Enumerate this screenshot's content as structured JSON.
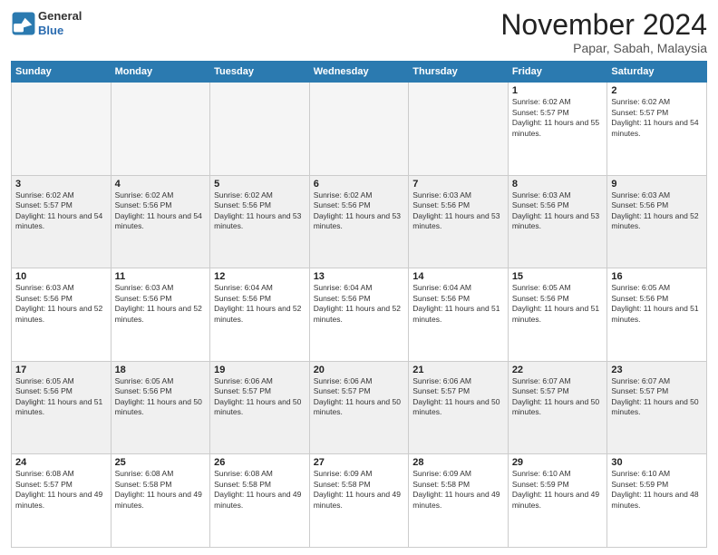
{
  "header": {
    "logo_general": "General",
    "logo_blue": "Blue",
    "month": "November 2024",
    "location": "Papar, Sabah, Malaysia"
  },
  "days_of_week": [
    "Sunday",
    "Monday",
    "Tuesday",
    "Wednesday",
    "Thursday",
    "Friday",
    "Saturday"
  ],
  "weeks": [
    [
      {
        "day": "",
        "empty": true
      },
      {
        "day": "",
        "empty": true
      },
      {
        "day": "",
        "empty": true
      },
      {
        "day": "",
        "empty": true
      },
      {
        "day": "",
        "empty": true
      },
      {
        "day": "1",
        "sunrise": "6:02 AM",
        "sunset": "5:57 PM",
        "daylight": "11 hours and 55 minutes."
      },
      {
        "day": "2",
        "sunrise": "6:02 AM",
        "sunset": "5:57 PM",
        "daylight": "11 hours and 54 minutes."
      }
    ],
    [
      {
        "day": "3",
        "sunrise": "6:02 AM",
        "sunset": "5:57 PM",
        "daylight": "11 hours and 54 minutes."
      },
      {
        "day": "4",
        "sunrise": "6:02 AM",
        "sunset": "5:56 PM",
        "daylight": "11 hours and 54 minutes."
      },
      {
        "day": "5",
        "sunrise": "6:02 AM",
        "sunset": "5:56 PM",
        "daylight": "11 hours and 53 minutes."
      },
      {
        "day": "6",
        "sunrise": "6:02 AM",
        "sunset": "5:56 PM",
        "daylight": "11 hours and 53 minutes."
      },
      {
        "day": "7",
        "sunrise": "6:03 AM",
        "sunset": "5:56 PM",
        "daylight": "11 hours and 53 minutes."
      },
      {
        "day": "8",
        "sunrise": "6:03 AM",
        "sunset": "5:56 PM",
        "daylight": "11 hours and 53 minutes."
      },
      {
        "day": "9",
        "sunrise": "6:03 AM",
        "sunset": "5:56 PM",
        "daylight": "11 hours and 52 minutes."
      }
    ],
    [
      {
        "day": "10",
        "sunrise": "6:03 AM",
        "sunset": "5:56 PM",
        "daylight": "11 hours and 52 minutes."
      },
      {
        "day": "11",
        "sunrise": "6:03 AM",
        "sunset": "5:56 PM",
        "daylight": "11 hours and 52 minutes."
      },
      {
        "day": "12",
        "sunrise": "6:04 AM",
        "sunset": "5:56 PM",
        "daylight": "11 hours and 52 minutes."
      },
      {
        "day": "13",
        "sunrise": "6:04 AM",
        "sunset": "5:56 PM",
        "daylight": "11 hours and 52 minutes."
      },
      {
        "day": "14",
        "sunrise": "6:04 AM",
        "sunset": "5:56 PM",
        "daylight": "11 hours and 51 minutes."
      },
      {
        "day": "15",
        "sunrise": "6:05 AM",
        "sunset": "5:56 PM",
        "daylight": "11 hours and 51 minutes."
      },
      {
        "day": "16",
        "sunrise": "6:05 AM",
        "sunset": "5:56 PM",
        "daylight": "11 hours and 51 minutes."
      }
    ],
    [
      {
        "day": "17",
        "sunrise": "6:05 AM",
        "sunset": "5:56 PM",
        "daylight": "11 hours and 51 minutes."
      },
      {
        "day": "18",
        "sunrise": "6:05 AM",
        "sunset": "5:56 PM",
        "daylight": "11 hours and 50 minutes."
      },
      {
        "day": "19",
        "sunrise": "6:06 AM",
        "sunset": "5:57 PM",
        "daylight": "11 hours and 50 minutes."
      },
      {
        "day": "20",
        "sunrise": "6:06 AM",
        "sunset": "5:57 PM",
        "daylight": "11 hours and 50 minutes."
      },
      {
        "day": "21",
        "sunrise": "6:06 AM",
        "sunset": "5:57 PM",
        "daylight": "11 hours and 50 minutes."
      },
      {
        "day": "22",
        "sunrise": "6:07 AM",
        "sunset": "5:57 PM",
        "daylight": "11 hours and 50 minutes."
      },
      {
        "day": "23",
        "sunrise": "6:07 AM",
        "sunset": "5:57 PM",
        "daylight": "11 hours and 50 minutes."
      }
    ],
    [
      {
        "day": "24",
        "sunrise": "6:08 AM",
        "sunset": "5:57 PM",
        "daylight": "11 hours and 49 minutes."
      },
      {
        "day": "25",
        "sunrise": "6:08 AM",
        "sunset": "5:58 PM",
        "daylight": "11 hours and 49 minutes."
      },
      {
        "day": "26",
        "sunrise": "6:08 AM",
        "sunset": "5:58 PM",
        "daylight": "11 hours and 49 minutes."
      },
      {
        "day": "27",
        "sunrise": "6:09 AM",
        "sunset": "5:58 PM",
        "daylight": "11 hours and 49 minutes."
      },
      {
        "day": "28",
        "sunrise": "6:09 AM",
        "sunset": "5:58 PM",
        "daylight": "11 hours and 49 minutes."
      },
      {
        "day": "29",
        "sunrise": "6:10 AM",
        "sunset": "5:59 PM",
        "daylight": "11 hours and 49 minutes."
      },
      {
        "day": "30",
        "sunrise": "6:10 AM",
        "sunset": "5:59 PM",
        "daylight": "11 hours and 48 minutes."
      }
    ]
  ]
}
